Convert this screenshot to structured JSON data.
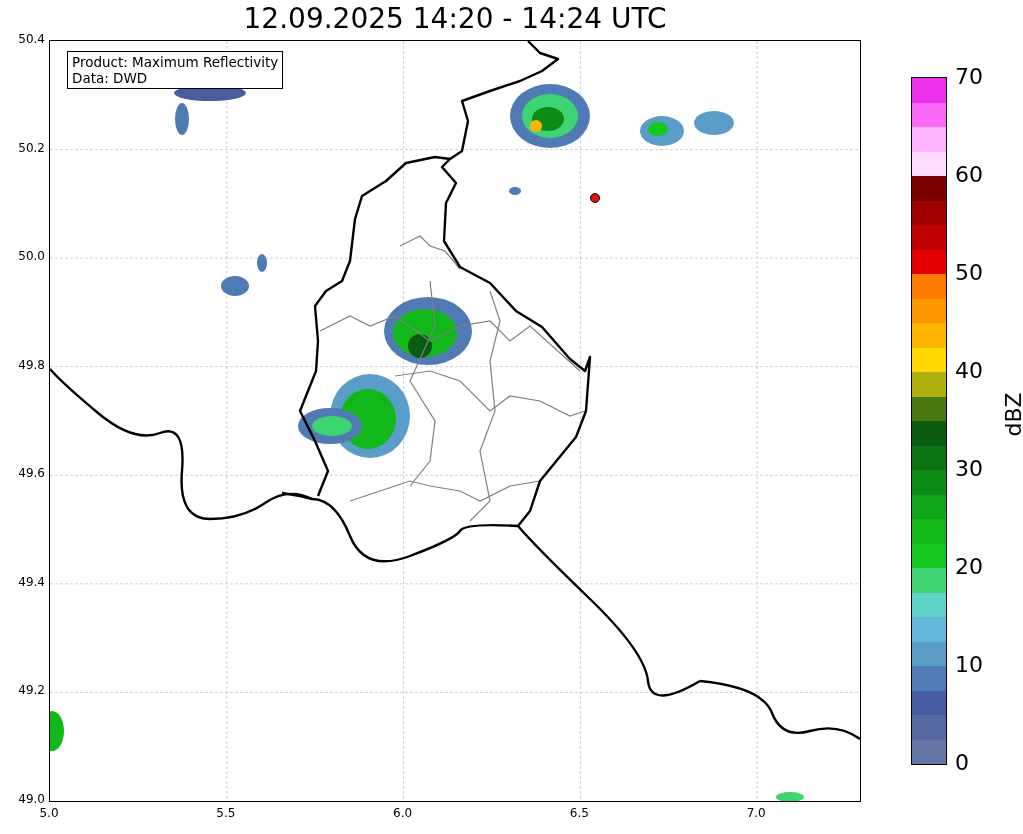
{
  "title": "12.09.2025 14:20 - 14:24 UTC",
  "info_box": {
    "lines": [
      "Product: Maximum Reflectivity",
      "Data: DWD"
    ]
  },
  "x_axis": {
    "ticks": [
      "5.0",
      "5.5",
      "6.0",
      "6.5",
      "7.0"
    ]
  },
  "y_axis": {
    "ticks": [
      "50.4",
      "50.2",
      "50.0",
      "49.8",
      "49.6",
      "49.4",
      "49.2",
      "49.0"
    ]
  },
  "colorbar": {
    "label": "dBZ",
    "ticks": [
      "70",
      "60",
      "50",
      "40",
      "30",
      "20",
      "10",
      "0"
    ],
    "bins": [
      {
        "color": "#6676a6"
      },
      {
        "color": "#5668a0"
      },
      {
        "color": "#465da0"
      },
      {
        "color": "#4f7ab4"
      },
      {
        "color": "#5a9ec8"
      },
      {
        "color": "#62b8dc"
      },
      {
        "color": "#60d4c8"
      },
      {
        "color": "#3ed474"
      },
      {
        "color": "#14c81e"
      },
      {
        "color": "#12b81a"
      },
      {
        "color": "#0fa618"
      },
      {
        "color": "#0c8c14"
      },
      {
        "color": "#0a7414"
      },
      {
        "color": "#0a5c10"
      },
      {
        "color": "#4a7810"
      },
      {
        "color": "#b0b010"
      },
      {
        "color": "#ffd800"
      },
      {
        "color": "#ffb400"
      },
      {
        "color": "#ff9800"
      },
      {
        "color": "#ff7c00"
      },
      {
        "color": "#e40000"
      },
      {
        "color": "#c00000"
      },
      {
        "color": "#a00000"
      },
      {
        "color": "#7a0000"
      },
      {
        "color": "#ffdcff"
      },
      {
        "color": "#ffb4ff"
      },
      {
        "color": "#fa6af8"
      },
      {
        "color": "#ec30ec"
      }
    ]
  }
}
